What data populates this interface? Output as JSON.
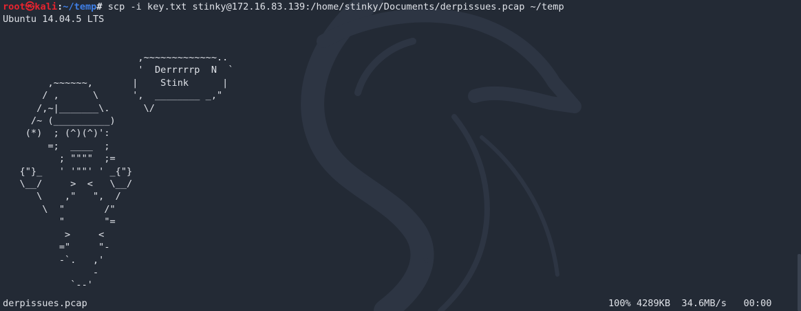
{
  "window": {
    "background": "#232a35",
    "watermark_icon": "kali-dragon-icon"
  },
  "prompt": {
    "user_host": "root㉿kali",
    "separator": ":",
    "directory": "~/temp",
    "symbol": "#",
    "command": " scp -i key.txt stinky@172.16.83.139:/home/stinky/Documents/derpissues.pcap ~/temp",
    "colors": {
      "user": "#e8242f",
      "directory": "#3f7fe6"
    }
  },
  "output": {
    "os_banner": "Ubuntu 14.04.5 LTS",
    "ascii_art": "                        ,~~~~~~~~~~~~~..\n                        '  Derrrrrp  N  `\n        ,~~~~~~,       |    Stink      |\n       / ,      \\      ',  ________ _,\"\n      /,~|_______\\.      \\/\n     /~ (__________)\n    (*)  ; (^)(^)':\n        =;  ____  ;\n          ; \"\"\"\"  ;=\n   {\"}_   ' '\"\"' ' _{\"}\n   \\__/     >  <   \\__/\n      \\    ,\"   \",  /\n       \\  \"       /\"\n          \"       \"=\n           >     <\n          =\"     \"-\n          -`.   ,'\n                -\n            `--'"
  },
  "transfer": {
    "filename": "derpissues.pcap",
    "percent": "100%",
    "size": "4289KB",
    "rate": "34.6MB/s",
    "eta": "00:00"
  }
}
